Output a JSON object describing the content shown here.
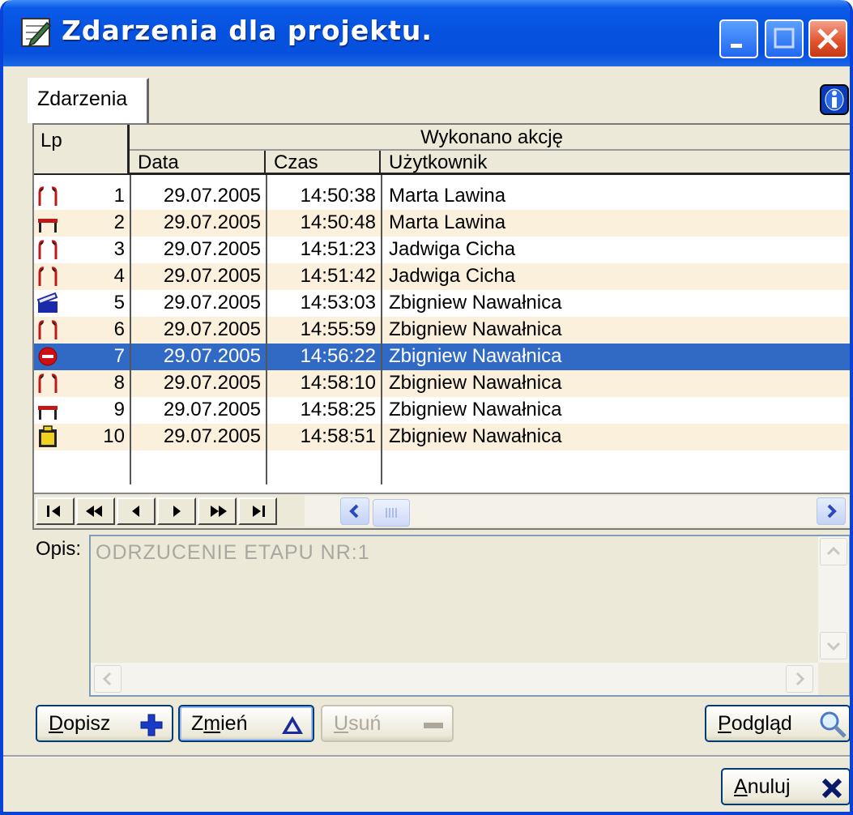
{
  "window": {
    "title": "Zdarzenia dla projektu."
  },
  "tabs": [
    {
      "label": "Zdarzenia"
    }
  ],
  "grid": {
    "col_lp": "Lp",
    "group_header": "Wykonano akcję",
    "col_data": "Data",
    "col_czas": "Czas",
    "col_user": "Użytkownik",
    "rows": [
      {
        "icon": "arch-red-icon",
        "lp": "1",
        "data": "29.07.2005",
        "czas": "14:50:38",
        "user": "Marta Lawina"
      },
      {
        "icon": "bridge-red-icon",
        "lp": "2",
        "data": "29.07.2005",
        "czas": "14:50:48",
        "user": "Marta Lawina"
      },
      {
        "icon": "arch-red-icon",
        "lp": "3",
        "data": "29.07.2005",
        "czas": "14:51:23",
        "user": "Jadwiga Cicha"
      },
      {
        "icon": "arch-red-icon",
        "lp": "4",
        "data": "29.07.2005",
        "czas": "14:51:42",
        "user": "Jadwiga Cicha"
      },
      {
        "icon": "clapper-blue-icon",
        "lp": "5",
        "data": "29.07.2005",
        "czas": "14:53:03",
        "user": "Zbigniew Nawałnica"
      },
      {
        "icon": "arch-red-icon",
        "lp": "6",
        "data": "29.07.2005",
        "czas": "14:55:59",
        "user": "Zbigniew Nawałnica"
      },
      {
        "icon": "stop-red-icon",
        "lp": "7",
        "data": "29.07.2005",
        "czas": "14:56:22",
        "user": "Zbigniew Nawałnica"
      },
      {
        "icon": "arch-red-icon",
        "lp": "8",
        "data": "29.07.2005",
        "czas": "14:58:10",
        "user": "Zbigniew Nawałnica"
      },
      {
        "icon": "bridge-red-icon",
        "lp": "9",
        "data": "29.07.2005",
        "czas": "14:58:25",
        "user": "Zbigniew Nawałnica"
      },
      {
        "icon": "clipboard-yellow-icon",
        "lp": "10",
        "data": "29.07.2005",
        "czas": "14:58:51",
        "user": "Zbigniew Nawałnica"
      }
    ],
    "selected_row": 7
  },
  "opis": {
    "label": "Opis:",
    "value": "ODRZUCENIE ETAPU NR:1"
  },
  "buttons": {
    "dopisz": {
      "mnemonic": "D",
      "rest": "opisz"
    },
    "zmien": {
      "pre": "Z",
      "mnemonic": "m",
      "rest": "ień"
    },
    "usun": {
      "mnemonic": "U",
      "rest": "suń"
    },
    "podglad": {
      "mnemonic": "P",
      "rest": "odgląd"
    },
    "anuluj": {
      "mnemonic": "A",
      "rest": "nuluj"
    }
  },
  "colors": {
    "title_bar": "#0653e0",
    "selection": "#316ac5",
    "row_alt": "#fbf0dc",
    "face": "#ece9d8"
  }
}
